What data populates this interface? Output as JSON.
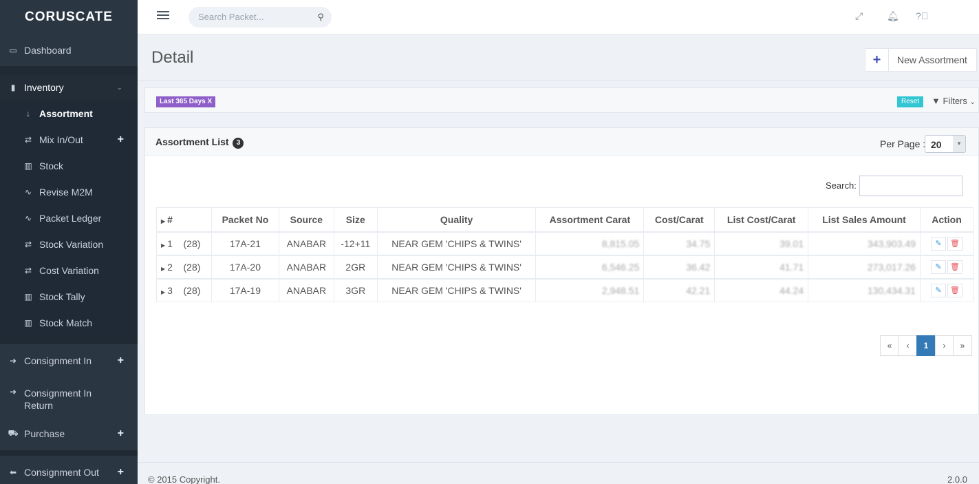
{
  "brand": "CORUSCATE",
  "sidebar": {
    "dashboard": "Dashboard",
    "inventory": "Inventory",
    "sub_items": [
      {
        "label": "Assortment",
        "icon": "sort-alpha-icon"
      },
      {
        "label": "Mix In/Out",
        "icon": "exchange-icon"
      },
      {
        "label": "Stock",
        "icon": "bar-chart-icon"
      },
      {
        "label": "Revise M2M",
        "icon": "line-chart-icon"
      },
      {
        "label": "Packet Ledger",
        "icon": "line-chart-icon"
      },
      {
        "label": "Stock Variation",
        "icon": "exchange-icon"
      },
      {
        "label": "Cost Variation",
        "icon": "exchange-icon"
      },
      {
        "label": "Stock Tally",
        "icon": "bar-chart-icon"
      },
      {
        "label": "Stock Match",
        "icon": "bar-chart-icon"
      }
    ],
    "consignment_in": "Consignment In",
    "consignment_in_return": "Consignment In Return",
    "purchase": "Purchase",
    "consignment_out": "Consignment Out"
  },
  "header": {
    "search_placeholder": "Search Packet..."
  },
  "page": {
    "title": "Detail",
    "new_button": "New Assortment",
    "filter_tag": "Last 365 Days X",
    "reset": "Reset",
    "filters": "Filters"
  },
  "panel": {
    "title": "Assortment List",
    "count": "3",
    "per_page_label": "Per Page :",
    "per_page_value": "20",
    "search_label": "Search:"
  },
  "table": {
    "headers": [
      "#",
      "Packet No",
      "Source",
      "Size",
      "Quality",
      "Assortment Carat",
      "Cost/Carat",
      "List Cost/Carat",
      "List Sales Amount",
      "Action"
    ],
    "rows": [
      {
        "idx": "1",
        "group": "(28)",
        "packet": "17A-21",
        "source": "ANABAR",
        "size": "-12+11",
        "quality": "NEAR GEM 'CHIPS & TWINS'",
        "carat": "8,815.05",
        "cost": "34.75",
        "list_cost": "39.01",
        "sales": "343,903.49"
      },
      {
        "idx": "2",
        "group": "(28)",
        "packet": "17A-20",
        "source": "ANABAR",
        "size": "2GR",
        "quality": "NEAR GEM 'CHIPS & TWINS'",
        "carat": "6,546.25",
        "cost": "36.42",
        "list_cost": "41.71",
        "sales": "273,017.26"
      },
      {
        "idx": "3",
        "group": "(28)",
        "packet": "17A-19",
        "source": "ANABAR",
        "size": "3GR",
        "quality": "NEAR GEM 'CHIPS & TWINS'",
        "carat": "2,948.51",
        "cost": "42.21",
        "list_cost": "44.24",
        "sales": "130,434.31"
      }
    ]
  },
  "pagination": {
    "first": "«",
    "prev": "‹",
    "current": "1",
    "next": "›",
    "last": "»"
  },
  "footer": {
    "copyright": "© 2015 Copyright.",
    "version": "2.0.0"
  }
}
